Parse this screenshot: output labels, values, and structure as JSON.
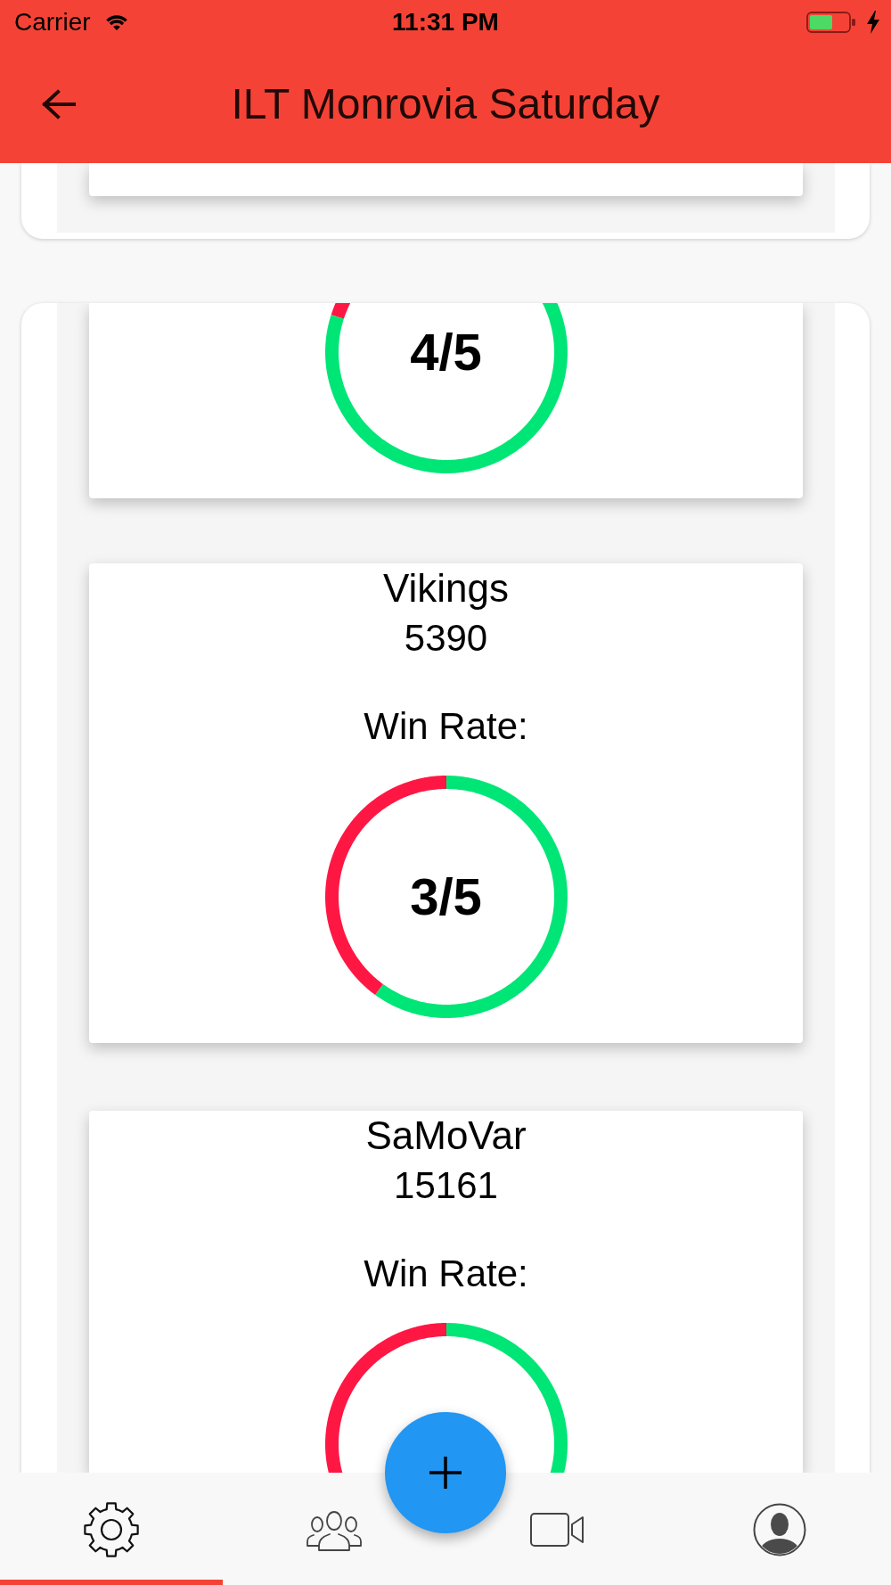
{
  "status_bar": {
    "carrier": "Carrier",
    "time": "11:31 PM"
  },
  "app_bar": {
    "title": "ILT Monrovia Saturday"
  },
  "teams": [
    {
      "win_rate": "4/5",
      "chart_data": {
        "type": "donut",
        "values": [
          80,
          20
        ]
      }
    },
    {
      "name": "Vikings",
      "score": "5390",
      "win_rate_label": "Win Rate:",
      "win_rate": "3/5",
      "chart_data": {
        "type": "donut",
        "values": [
          60,
          40
        ]
      }
    },
    {
      "name": "SaMoVar",
      "score": "15161",
      "win_rate_label": "Win Rate:"
    }
  ],
  "nav_tabs": [
    {
      "kind": "settings",
      "selected": true
    },
    {
      "kind": "people",
      "selected": false
    },
    {
      "kind": "video",
      "selected": false
    },
    {
      "kind": "profile",
      "selected": false
    }
  ]
}
